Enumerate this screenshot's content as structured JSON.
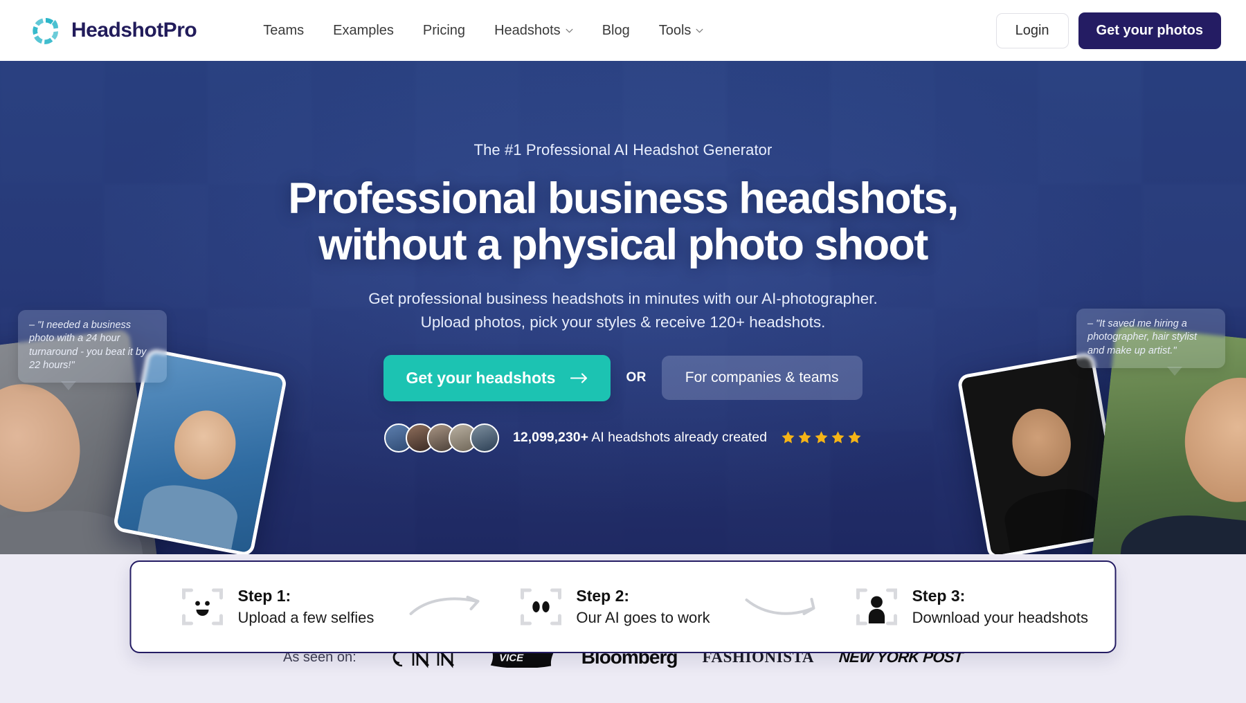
{
  "nav": {
    "brand": "HeadshotPro",
    "logo_icon": "headshotpro-petal-logo",
    "links": [
      {
        "label": "Teams",
        "icon": null
      },
      {
        "label": "Examples",
        "icon": null
      },
      {
        "label": "Pricing",
        "icon": null
      },
      {
        "label": "Headshots",
        "icon": "chevron-down-icon"
      },
      {
        "label": "Blog",
        "icon": null
      },
      {
        "label": "Tools",
        "icon": "chevron-down-icon"
      }
    ],
    "login_label": "Login",
    "cta_label": "Get your photos"
  },
  "hero": {
    "eyebrow": "The #1 Professional AI Headshot Generator",
    "headline_line1": "Professional business headshots,",
    "headline_line2": "without a physical photo shoot",
    "sub_line1": "Get professional business headshots in minutes with our AI-photographer.",
    "sub_line2": "Upload photos, pick your styles & receive 120+ headshots.",
    "cta_primary": "Get your headshots",
    "cta_primary_icon": "arrow-right-icon",
    "or_label": "OR",
    "cta_secondary": "For companies & teams",
    "proof_count": "12,099,230+",
    "proof_text": "AI headshots already created",
    "rating_stars": 5,
    "quote_left": "– \"I needed a business photo with a 24 hour turnaround - you beat it by 22 hours!\"",
    "quote_right": "– \"It saved me hiring a photographer, hair stylist and make up artist.\""
  },
  "steps": [
    {
      "title": "Step 1:",
      "text": "Upload a few selfies",
      "icon": "face-scan-smile-icon"
    },
    {
      "title": "Step 2:",
      "text": "Our AI goes to work",
      "icon": "face-scan-eyes-icon"
    },
    {
      "title": "Step 3:",
      "text": "Download your headshots",
      "icon": "face-scan-person-icon"
    }
  ],
  "press": {
    "label": "As seen on:",
    "logos": [
      {
        "name": "CNN"
      },
      {
        "name": "VICE"
      },
      {
        "name": "Bloomberg"
      },
      {
        "name": "FASHIONISTA"
      },
      {
        "name": "NEW YORK POST"
      }
    ]
  },
  "colors": {
    "brand_navy": "#241C63",
    "teal_accent": "#1CC3B2",
    "hero_blue": "#2F4A87",
    "star_gold": "#F5B417",
    "page_bg": "#EDEBF5"
  }
}
